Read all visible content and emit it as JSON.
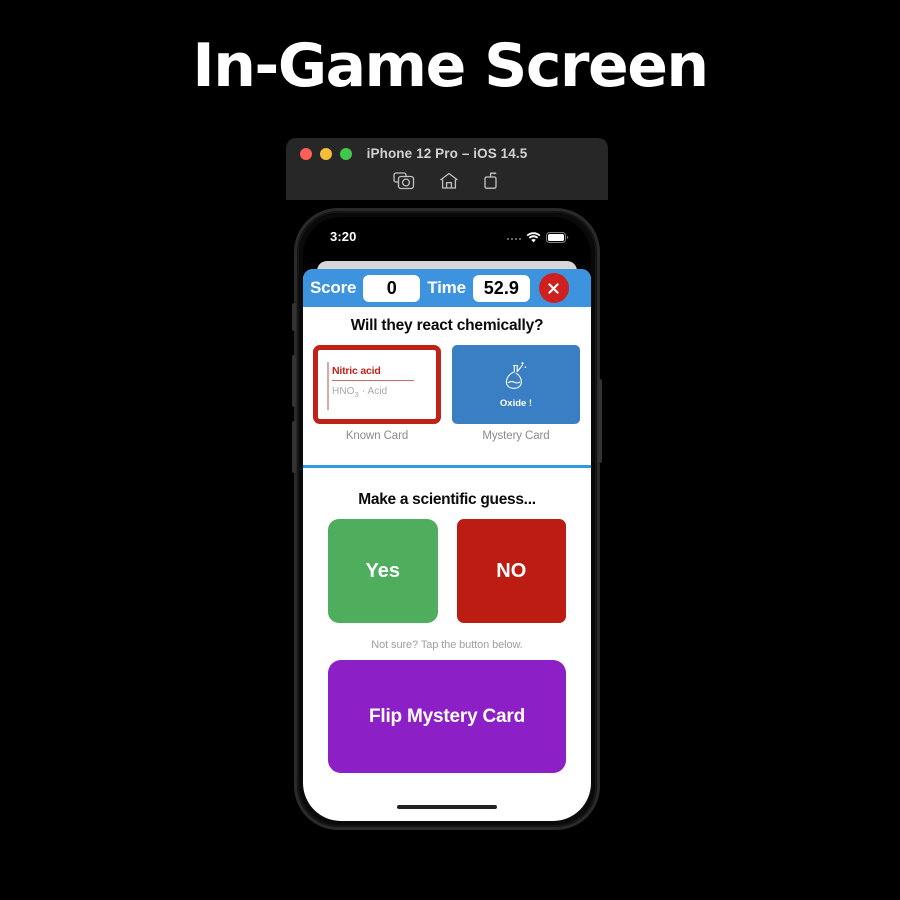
{
  "page": {
    "title": "In-Game Screen",
    "background_color": "#000000"
  },
  "simulator": {
    "window_title": "iPhone 12 Pro – iOS 14.5",
    "traffic_lights": [
      {
        "name": "close",
        "color": "#ff5f57"
      },
      {
        "name": "minimize",
        "color": "#f6bd3b"
      },
      {
        "name": "zoom",
        "color": "#41c84a"
      }
    ],
    "toolbar_icons": [
      "screenshot-camera-icon",
      "home-icon",
      "rotate-icon"
    ]
  },
  "status_bar": {
    "time": "3:20",
    "cellular_icon": "signal-dots-icon",
    "wifi_icon": "wifi-icon",
    "battery_icon": "battery-icon"
  },
  "hud": {
    "score_label": "Score",
    "score_value": "0",
    "time_label": "Time",
    "time_value": "52.9",
    "close_icon": "close-x-icon",
    "bar_color": "#3d93dd",
    "close_color": "#cf2020"
  },
  "question": {
    "text": "Will they react chemically?"
  },
  "cards": {
    "known": {
      "name": "Nitric acid",
      "subtitle": "HNO",
      "subtitle_sub": "3",
      "subtitle_tail": " · Acid",
      "caption": "Known Card",
      "border_color": "#bf2318"
    },
    "mystery": {
      "icon": "flask-icon",
      "label": "Oxide !",
      "caption": "Mystery Card",
      "background_color": "#3a7fc4"
    }
  },
  "guess": {
    "title": "Make a scientific guess...",
    "yes_label": "Yes",
    "no_label": "NO",
    "yes_color": "#4eae5d",
    "no_color": "#bd1c12",
    "hint": "Not sure? Tap the button below.",
    "flip_label": "Flip Mystery Card",
    "flip_color": "#8c1fc6"
  }
}
